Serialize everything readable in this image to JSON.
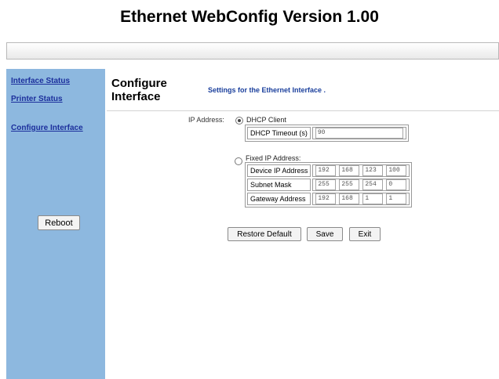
{
  "page_title": "Ethernet WebConfig Version 1.00",
  "sidebar": {
    "items": [
      {
        "label": "Interface Status"
      },
      {
        "label": "Printer Status"
      },
      {
        "label": "Configure Interface"
      }
    ],
    "reboot_label": "Reboot"
  },
  "main": {
    "heading_line1": "Configure",
    "heading_line2": "Interface",
    "subtitle": "Settings for the Ethernet Interface ."
  },
  "form": {
    "ip_address_label": "IP Address:",
    "dhcp": {
      "label": "DHCP Client",
      "selected": true,
      "timeout_label": "DHCP Timeout (s)",
      "timeout_value": "90"
    },
    "fixed": {
      "label": "Fixed IP Address:",
      "selected": false,
      "device_ip_label": "Device IP Address",
      "device_ip": [
        "192",
        "168",
        "123",
        "100"
      ],
      "subnet_label": "Subnet Mask",
      "subnet": [
        "255",
        "255",
        "254",
        "0"
      ],
      "gateway_label": "Gateway Address",
      "gateway": [
        "192",
        "168",
        "1",
        "1"
      ]
    }
  },
  "buttons": {
    "restore": "Restore Default",
    "save": "Save",
    "exit": "Exit"
  },
  "colors": {
    "sidebar_bg": "#8db8df",
    "link": "#1c2f9c",
    "subtitle": "#1a3f9c"
  }
}
